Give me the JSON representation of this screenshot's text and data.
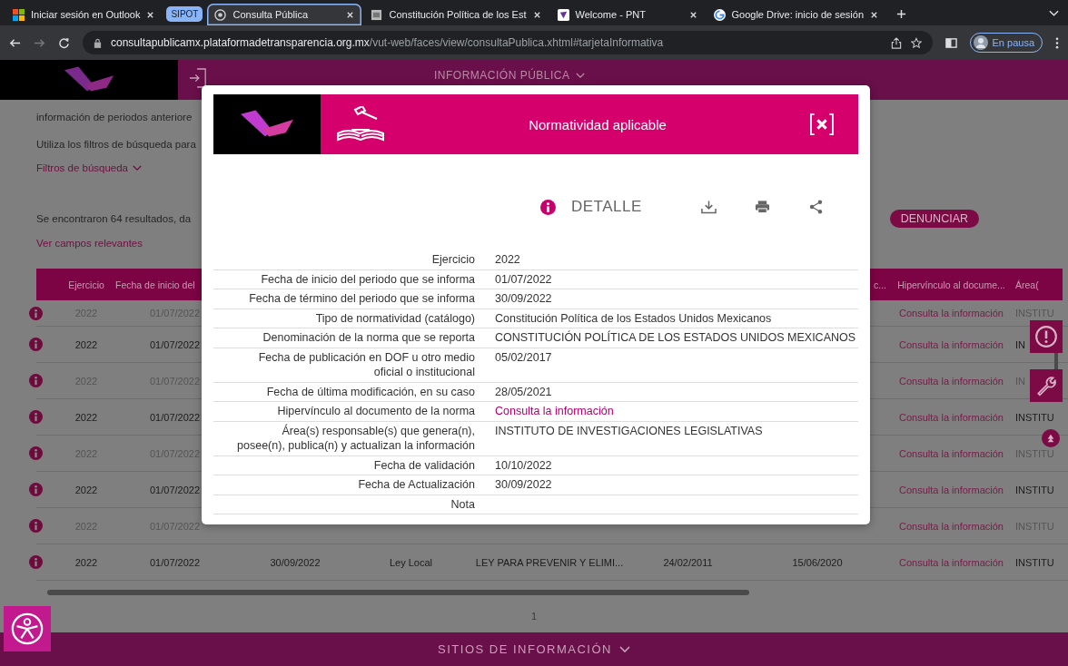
{
  "browser": {
    "tabs": [
      {
        "title": "Iniciar sesión en Outlook",
        "selected": false,
        "grouped": false
      },
      {
        "title": "Consulta Pública",
        "selected": true,
        "grouped": true
      },
      {
        "title": "Constitución Política de los Est",
        "selected": false,
        "grouped": false
      },
      {
        "title": "Welcome - PNT",
        "selected": false,
        "grouped": false
      },
      {
        "title": "Google Drive: inicio de sesión",
        "selected": false,
        "grouped": false
      }
    ],
    "tab_group": "SIPOT",
    "url_domain": "consultapublicamx.plataformadetransparencia.org.mx",
    "url_path": "/vut-web/faces/view/consultaPublica.xhtml#tarjetaInformativa",
    "profile_status": "En pausa"
  },
  "header": {
    "title": "INFORMACIÓN PÚBLICA"
  },
  "intro": [
    "información de periodos anteriore",
    "Utiliza los filtros de búsqueda para"
  ],
  "filters_link": "Filtros de búsqueda",
  "results_text": "Se encontraron 64 resultados, da",
  "relevant_fields_link": "Ver campos relevantes",
  "report_button": "DENUNCIAR",
  "table": {
    "header": {
      "ejercicio": "Ejercicio",
      "fecha_inicio": "Fecha de inicio del",
      "column_7": "c...",
      "hipervinculo": "Hipervínculo al docume...",
      "area": "Área("
    },
    "rows": [
      {
        "ejercicio": "2022",
        "fecha_inicio": "01/07/2022",
        "hipervinculo": "Consulta la información",
        "area": "INSTITU"
      },
      {
        "ejercicio": "2022",
        "fecha_inicio": "01/07/2022",
        "hipervinculo": "Consulta la información",
        "area": "IN"
      },
      {
        "ejercicio": "2022",
        "fecha_inicio": "01/07/2022",
        "hipervinculo": "Consulta la información",
        "area": "IN"
      },
      {
        "ejercicio": "2022",
        "fecha_inicio": "01/07/2022",
        "hipervinculo": "Consulta la información",
        "area": "INSTITU"
      },
      {
        "ejercicio": "2022",
        "fecha_inicio": "01/07/2022",
        "hipervinculo": "Consulta la información",
        "area": "INSTITU"
      },
      {
        "ejercicio": "2022",
        "fecha_inicio": "01/07/2022",
        "hipervinculo": "Consulta la información",
        "area": "INSTITU"
      },
      {
        "ejercicio": "2022",
        "fecha_inicio": "01/07/2022",
        "hipervinculo": "Consulta la información",
        "area": "INSTITU"
      },
      {
        "ejercicio": "2022",
        "fecha_inicio": "01/07/2022",
        "column_3": "30/09/2022",
        "column_4": "Ley Local",
        "column_5": "LEY PARA PREVENIR Y ELIMI...",
        "column_6": "24/02/2011",
        "column_7": "15/06/2020",
        "hipervinculo": "Consulta la información",
        "area": "INSTITU"
      }
    ]
  },
  "pagination": "1",
  "footer": "SITIOS DE INFORMACIÓN",
  "modal": {
    "title": "Normatividad aplicable",
    "section": "DETALLE",
    "fields": [
      {
        "label": "Ejercicio",
        "value": "2022",
        "kind": "text"
      },
      {
        "label": "Fecha de inicio del periodo que se informa",
        "value": "01/07/2022",
        "kind": "text"
      },
      {
        "label": "Fecha de término del periodo que se informa",
        "value": "30/09/2022",
        "kind": "text"
      },
      {
        "label": "Tipo de normatividad (catálogo)",
        "value": "Constitución Política de los Estados Unidos Mexicanos",
        "kind": "text"
      },
      {
        "label": "Denominación de la norma que se reporta",
        "value": "CONSTITUCIÓN POLÍTICA DE LOS ESTADOS UNIDOS MEXICANOS",
        "kind": "text"
      },
      {
        "label": "Fecha de publicación en DOF u otro medio oficial o institucional",
        "value": "05/02/2017",
        "kind": "text"
      },
      {
        "label": "Fecha de última modificación, en su caso",
        "value": "28/05/2021",
        "kind": "text"
      },
      {
        "label": "Hipervínculo al documento de la norma",
        "value": "Consulta la información",
        "kind": "link"
      },
      {
        "label": "Área(s) responsable(s) que genera(n), posee(n), publica(n) y actualizan la información",
        "value": "INSTITUTO DE INVESTIGACIONES LEGISLATIVAS",
        "kind": "text"
      },
      {
        "label": "Fecha de validación",
        "value": "10/10/2022",
        "kind": "text"
      },
      {
        "label": "Fecha de Actualización",
        "value": "30/09/2022",
        "kind": "text"
      },
      {
        "label": "Nota"
      }
    ]
  }
}
